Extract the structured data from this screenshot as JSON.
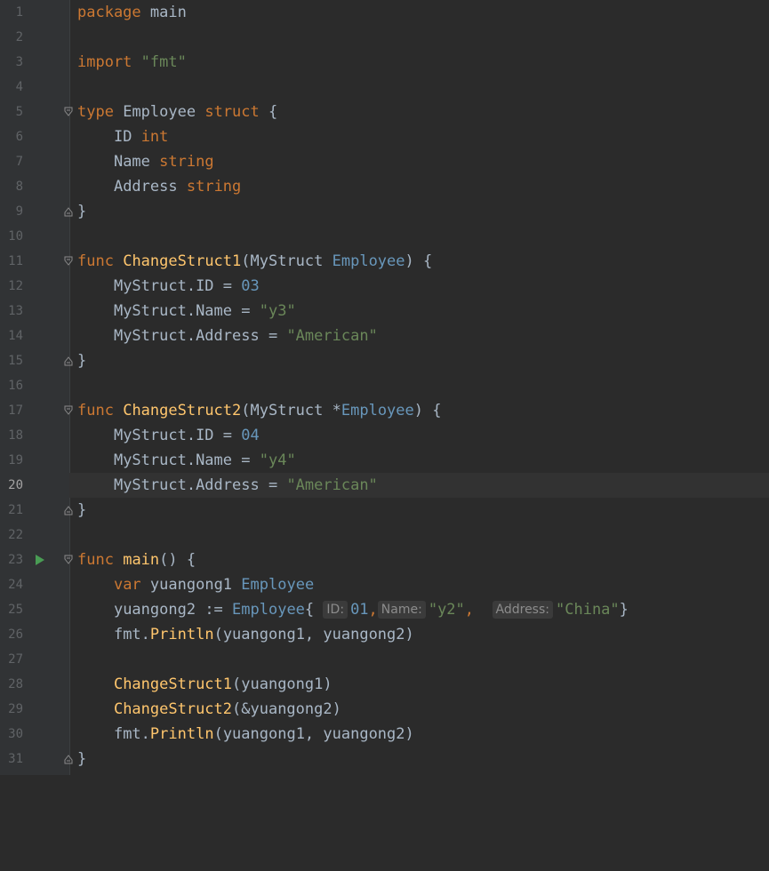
{
  "editor": {
    "current_line": 20,
    "line_numbers": [
      "1",
      "2",
      "3",
      "4",
      "5",
      "6",
      "7",
      "8",
      "9",
      "10",
      "11",
      "12",
      "13",
      "14",
      "15",
      "16",
      "17",
      "18",
      "19",
      "20",
      "21",
      "22",
      "23",
      "24",
      "25",
      "26",
      "27",
      "28",
      "29",
      "30",
      "31"
    ],
    "tokens": {
      "package": "package",
      "main_pkg": "main",
      "import": "import",
      "fmt_str": "\"fmt\"",
      "type": "type",
      "employee": "Employee",
      "struct": "struct",
      "brace_open": " {",
      "brace_close": "}",
      "id_field": "ID",
      "int": "int",
      "name_field": "Name",
      "string": "string",
      "address_field": "Address",
      "func": "func",
      "change1": "ChangeStruct1",
      "change2": "ChangeStruct2",
      "param1": "(MyStruct ",
      "param2": "(MyStruct ",
      "ptr": "*",
      "paren_brace": ") {",
      "ms_id": "MyStruct.ID",
      "ms_name": "MyStruct.Name",
      "ms_address": "MyStruct.Address",
      "eq": " = ",
      "n03": "03",
      "n04": "04",
      "y3": "\"y3\"",
      "y4": "\"y4\"",
      "american": "\"American\"",
      "main_fn": "main",
      "main_parens": "() {",
      "var": "var",
      "yg1": "yuangong1",
      "yg2": "yuangong2",
      "assign": " := ",
      "lbrace": "{",
      "rbrace": "}",
      "hint_id": "ID:",
      "hint_name": "Name:",
      "hint_address": "Address:",
      "n01": "01",
      "y2": "\"y2\"",
      "china": "\"China\"",
      "comma": ",",
      "fmt": "fmt",
      "println": "Println",
      "dot": ".",
      "args": "(yuangong1, yuangong2)",
      "call1_args": "(yuangong1)",
      "call2_args": "(&yuangong2)"
    }
  }
}
